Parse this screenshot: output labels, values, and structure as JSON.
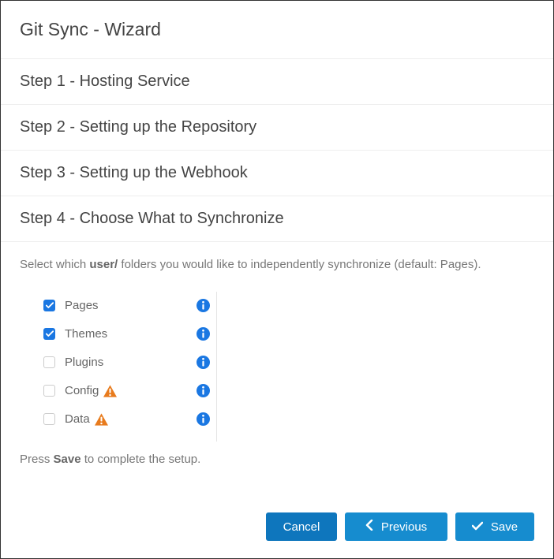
{
  "title": "Git Sync - Wizard",
  "steps": [
    "Step 1 - Hosting Service",
    "Step 2 - Setting up the Repository",
    "Step 3 - Setting up the Webhook",
    "Step 4 - Choose What to Synchronize"
  ],
  "instruction": {
    "prefix": "Select which ",
    "bold": "user/",
    "suffix": " folders you would like to independently synchronize (default: Pages)."
  },
  "sync_items": [
    {
      "label": "Pages",
      "checked": true,
      "warn": false
    },
    {
      "label": "Themes",
      "checked": true,
      "warn": false
    },
    {
      "label": "Plugins",
      "checked": false,
      "warn": false
    },
    {
      "label": "Config",
      "checked": false,
      "warn": true
    },
    {
      "label": "Data",
      "checked": false,
      "warn": true
    }
  ],
  "save_instruction": {
    "prefix": "Press ",
    "bold": "Save",
    "suffix": " to complete the setup."
  },
  "buttons": {
    "cancel": "Cancel",
    "previous": "Previous",
    "save": "Save"
  },
  "colors": {
    "info": "#1a77e2",
    "warn": "#e87b1d",
    "btnCancel": "#0e76bd",
    "btnAction": "#168ccf"
  }
}
